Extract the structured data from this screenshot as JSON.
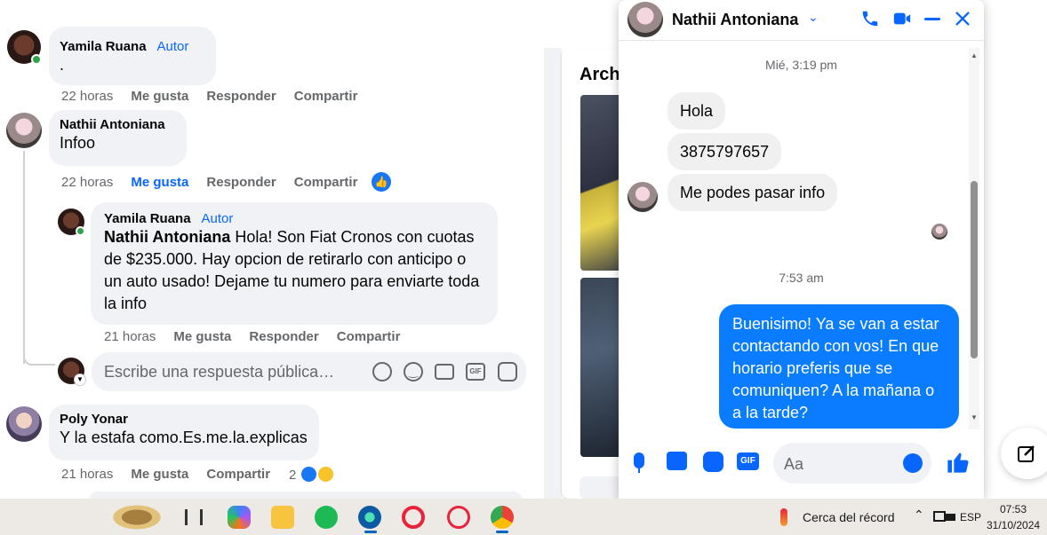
{
  "feed": {
    "comments": [
      {
        "name": "Yamila Ruana",
        "author": "Autor",
        "text": ".",
        "time": "22 horas",
        "like": "Me gusta",
        "reply": "Responder",
        "share": "Compartir"
      },
      {
        "name": "Nathii Antoniana",
        "text": "Infoo",
        "time": "22 horas",
        "like": "Me gusta",
        "reply": "Responder",
        "share": "Compartir"
      },
      {
        "name": "Yamila Ruana",
        "author": "Autor",
        "mention": "Nathii Antoniana",
        "text": " Hola! Son Fiat Cronos con cuotas de $235.000. Hay opcion de retirarlo con anticipo o un auto usado! Dejame tu numero para enviarte toda la info",
        "time": "21 horas",
        "like": "Me gusta",
        "reply": "Responder",
        "share": "Compartir"
      },
      {
        "name": "Poly Yonar",
        "text": "Y la estafa como.Es.me.la.explicas",
        "time": "21 horas",
        "like": "Me gusta",
        "share": "Compartir",
        "reactions": "2"
      }
    ],
    "reply_placeholder": "Escribe una respuesta pública…",
    "side_title": "Arch"
  },
  "chat": {
    "contact": "Nathii Antoniana",
    "timestamp1": "Mié, 3:19 pm",
    "timestamp2": "7:53 am",
    "incoming": [
      "Hola",
      "3875797657",
      "Me podes pasar info"
    ],
    "outgoing": "Buenisimo! Ya se van a estar contactando con vos! En que horario preferis que se comuniquen? A la mañana o a la tarde?",
    "input_placeholder": "Aa"
  },
  "taskbar": {
    "weather": "Cerca del récord",
    "lang": "ESP",
    "time": "07:53",
    "date": "31/10/2024"
  },
  "colors": {
    "accent": "#0866ff",
    "chat_bubble_out": "#0a7cff"
  }
}
